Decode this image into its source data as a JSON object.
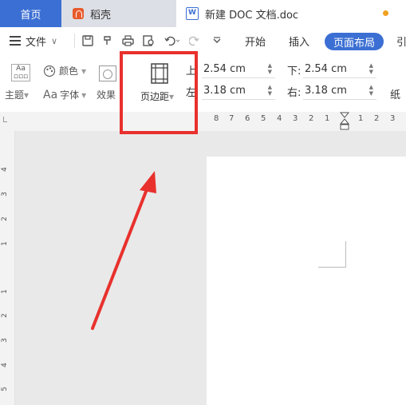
{
  "tabs": {
    "home": "首页",
    "daoke": "稻壳",
    "doc": "新建 DOC 文档.doc"
  },
  "menu": {
    "file": "文件",
    "file_dropdown": "∨",
    "start": "开始",
    "insert": "插入",
    "page_layout": "页面布局",
    "more": "引"
  },
  "ribbon": {
    "theme": "主题",
    "theme_arrow": "▾",
    "color": "颜色",
    "color_arrow": "▾",
    "font_icon_text": "Aa",
    "font": "字体",
    "font_arrow": "▾",
    "effect": "效果",
    "margins": "页边距",
    "margins_arrow": "▾",
    "paper": "纸",
    "top_label": "上",
    "top_value": "2.54 cm",
    "bottom_label": "下:",
    "bottom_value": "2.54 cm",
    "left_label": "左",
    "left_value": "3.18 cm",
    "right_label": "右:",
    "right_value": "3.18 cm"
  },
  "ruler": {
    "h_numbers": [
      "8",
      "7",
      "6",
      "5",
      "4",
      "3",
      "2",
      "1",
      "1",
      "2",
      "3"
    ],
    "v_numbers": [
      "4",
      "3",
      "2",
      "1",
      "1",
      "2",
      "3",
      "4",
      "5"
    ]
  },
  "colors": {
    "accent": "#3b6fd3",
    "highlight": "#e8312d"
  }
}
